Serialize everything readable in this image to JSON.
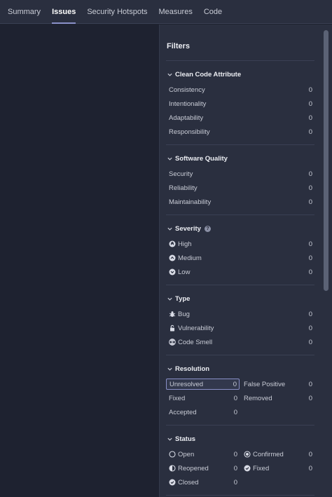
{
  "tabs": [
    {
      "label": "Summary"
    },
    {
      "label": "Issues"
    },
    {
      "label": "Security Hotspots"
    },
    {
      "label": "Measures"
    },
    {
      "label": "Code"
    }
  ],
  "filters": {
    "title": "Filters",
    "clean_code": {
      "title": "Clean Code Attribute",
      "items": [
        {
          "label": "Consistency",
          "count": "0"
        },
        {
          "label": "Intentionality",
          "count": "0"
        },
        {
          "label": "Adaptability",
          "count": "0"
        },
        {
          "label": "Responsibility",
          "count": "0"
        }
      ]
    },
    "software_quality": {
      "title": "Software Quality",
      "items": [
        {
          "label": "Security",
          "count": "0"
        },
        {
          "label": "Reliability",
          "count": "0"
        },
        {
          "label": "Maintainability",
          "count": "0"
        }
      ]
    },
    "severity": {
      "title": "Severity",
      "help": "?",
      "items": [
        {
          "label": "High",
          "count": "0",
          "icon": "severity-high-icon"
        },
        {
          "label": "Medium",
          "count": "0",
          "icon": "severity-medium-icon"
        },
        {
          "label": "Low",
          "count": "0",
          "icon": "severity-low-icon"
        }
      ]
    },
    "type": {
      "title": "Type",
      "items": [
        {
          "label": "Bug",
          "count": "0",
          "icon": "bug-icon"
        },
        {
          "label": "Vulnerability",
          "count": "0",
          "icon": "lock-icon"
        },
        {
          "label": "Code Smell",
          "count": "0",
          "icon": "code-smell-icon"
        }
      ]
    },
    "resolution": {
      "title": "Resolution",
      "items": [
        {
          "label": "Unresolved",
          "count": "0",
          "selected": true
        },
        {
          "label": "False Positive",
          "count": "0"
        },
        {
          "label": "Fixed",
          "count": "0"
        },
        {
          "label": "Removed",
          "count": "0"
        },
        {
          "label": "Accepted",
          "count": "0"
        }
      ]
    },
    "status": {
      "title": "Status",
      "items": [
        {
          "label": "Open",
          "count": "0",
          "icon": "status-open-icon"
        },
        {
          "label": "Confirmed",
          "count": "0",
          "icon": "status-confirmed-icon"
        },
        {
          "label": "Reopened",
          "count": "0",
          "icon": "status-reopened-icon"
        },
        {
          "label": "Fixed",
          "count": "0",
          "icon": "status-fixed-icon"
        },
        {
          "label": "Closed",
          "count": "0",
          "icon": "status-closed-icon"
        }
      ]
    }
  },
  "colors": {
    "accent": "#8a90c8",
    "panel": "#2a2f3f",
    "background": "#1e2230"
  }
}
